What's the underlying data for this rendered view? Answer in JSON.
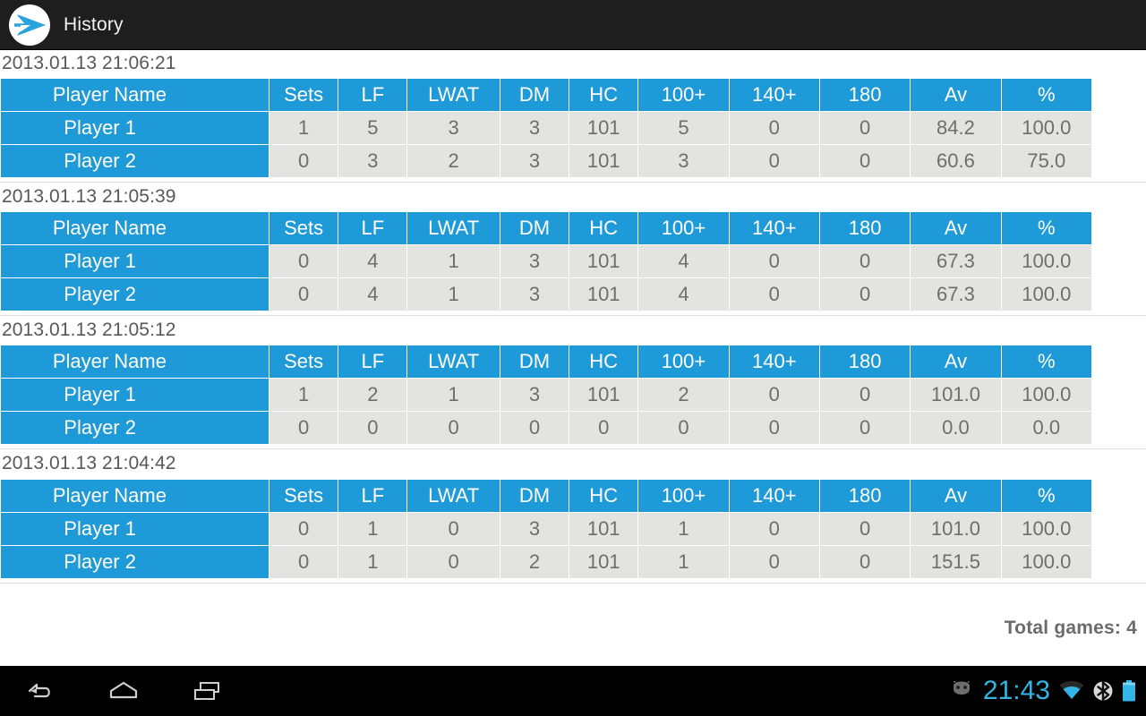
{
  "action_bar": {
    "title": "History",
    "logo_icon": "dart-arrow-logo-icon"
  },
  "table": {
    "columns": [
      "Player Name",
      "Sets",
      "LF",
      "LWAT",
      "DM",
      "HC",
      "100+",
      "140+",
      "180",
      "Av",
      "%"
    ]
  },
  "games": [
    {
      "date": "2013.01.13 21:06:21",
      "rows": [
        {
          "name": "Player 1",
          "values": [
            "1",
            "5",
            "3",
            "3",
            "101",
            "5",
            "0",
            "0",
            "84.2",
            "100.0"
          ]
        },
        {
          "name": "Player 2",
          "values": [
            "0",
            "3",
            "2",
            "3",
            "101",
            "3",
            "0",
            "0",
            "60.6",
            "75.0"
          ]
        }
      ]
    },
    {
      "date": "2013.01.13 21:05:39",
      "rows": [
        {
          "name": "Player 1",
          "values": [
            "0",
            "4",
            "1",
            "3",
            "101",
            "4",
            "0",
            "0",
            "67.3",
            "100.0"
          ]
        },
        {
          "name": "Player 2",
          "values": [
            "0",
            "4",
            "1",
            "3",
            "101",
            "4",
            "0",
            "0",
            "67.3",
            "100.0"
          ]
        }
      ]
    },
    {
      "date": "2013.01.13 21:05:12",
      "rows": [
        {
          "name": "Player 1",
          "values": [
            "1",
            "2",
            "1",
            "3",
            "101",
            "2",
            "0",
            "0",
            "101.0",
            "100.0"
          ]
        },
        {
          "name": "Player 2",
          "values": [
            "0",
            "0",
            "0",
            "0",
            "0",
            "0",
            "0",
            "0",
            "0.0",
            "0.0"
          ]
        }
      ]
    },
    {
      "date": "2013.01.13 21:04:42",
      "rows": [
        {
          "name": "Player 1",
          "values": [
            "0",
            "1",
            "0",
            "3",
            "101",
            "1",
            "0",
            "0",
            "101.0",
            "100.0"
          ]
        },
        {
          "name": "Player 2",
          "values": [
            "0",
            "1",
            "0",
            "2",
            "101",
            "1",
            "0",
            "0",
            "151.5",
            "100.0"
          ]
        }
      ]
    }
  ],
  "footer": {
    "total_games": "Total games: 4"
  },
  "system_bar": {
    "back_icon": "back-arrow-icon",
    "home_icon": "home-icon",
    "recents_icon": "recent-apps-icon",
    "notification_icon": "android-robot-icon",
    "clock": "21:43",
    "wifi_icon": "wifi-icon",
    "bluetooth_icon": "bluetooth-icon",
    "battery_icon": "battery-icon"
  },
  "colors": {
    "accent_blue": "#1f9ad8",
    "cell_gray": "#e3e3e1",
    "cell_text": "#6e6e6e",
    "action_bar": "#1e1e1e",
    "clock_blue": "#33b5e5"
  }
}
